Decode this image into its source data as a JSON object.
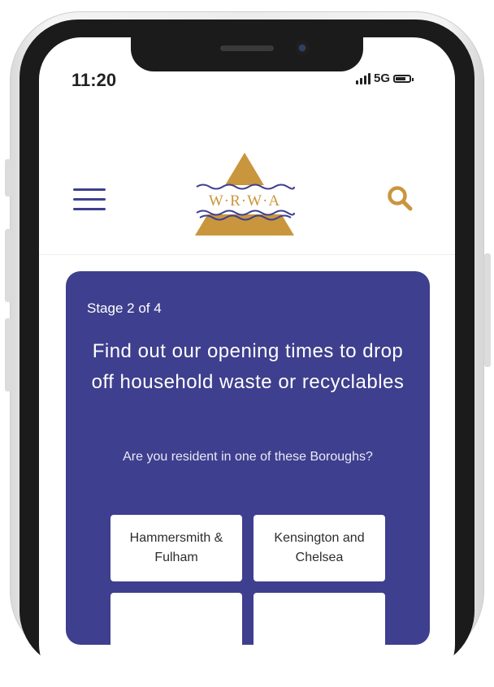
{
  "status_bar": {
    "time": "11:20",
    "network": "5G"
  },
  "header": {
    "logo_text": "W·R·W·A",
    "brand_colors": {
      "primary": "#3e3f8e",
      "accent": "#c9963d"
    }
  },
  "card": {
    "stage": "Stage 2 of 4",
    "title": "Find out our opening times to drop off household waste or recyclables",
    "question": "Are you resident in one of these Boroughs?",
    "boroughs": [
      {
        "label": "Hammersmith & Fulham"
      },
      {
        "label": "Kensington and Chelsea"
      },
      {
        "label": ""
      },
      {
        "label": ""
      }
    ]
  }
}
